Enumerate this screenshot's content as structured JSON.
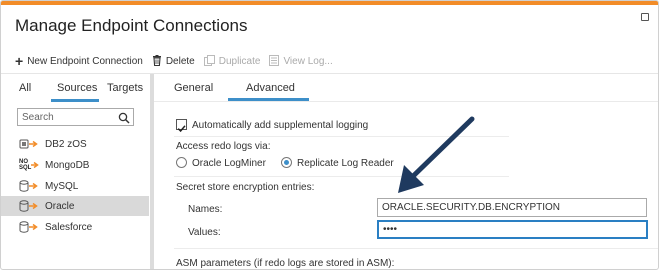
{
  "window": {
    "title": "Manage Endpoint Connections",
    "accent_color": "#f28c28",
    "maximize_icon": "maximize-icon"
  },
  "toolbar": {
    "new_label": "New Endpoint Connection",
    "delete_label": "Delete",
    "duplicate_label": "Duplicate",
    "view_log_label": "View Log..."
  },
  "left_tabs": [
    "All",
    "Sources",
    "Targets"
  ],
  "left_tabs_selected": "Sources",
  "search": {
    "placeholder": "Search"
  },
  "sources": [
    {
      "label": "DB2 zOS",
      "icon": "db2-icon"
    },
    {
      "label": "MongoDB",
      "icon": "nosql-icon",
      "icon_text": [
        "NO",
        "SQL"
      ]
    },
    {
      "label": "MySQL",
      "icon": "database-icon"
    },
    {
      "label": "Oracle",
      "icon": "database-icon",
      "selected": true
    },
    {
      "label": "Salesforce",
      "icon": "database-icon"
    }
  ],
  "right_tabs": [
    "General",
    "Advanced"
  ],
  "right_tabs_selected": "Advanced",
  "advanced": {
    "supplemental_logging_label": "Automatically add supplemental logging",
    "supplemental_logging_checked": true,
    "access_redo_label": "Access redo logs via:",
    "option_logminer": "Oracle LogMiner",
    "option_replicate": "Replicate Log Reader",
    "selected_option": "Replicate Log Reader",
    "secret_store_label": "Secret store encryption entries:",
    "names_label": "Names:",
    "names_value": "ORACLE.SECURITY.DB.ENCRYPTION",
    "values_label": "Values:",
    "values_value": "••••",
    "asm_label": "ASM parameters (if redo logs are stored in ASM):"
  },
  "colors": {
    "tab_underline": "#3d8fc9",
    "annotation_arrow": "#1f3a5f",
    "focus_border": "#2a7fc3"
  }
}
